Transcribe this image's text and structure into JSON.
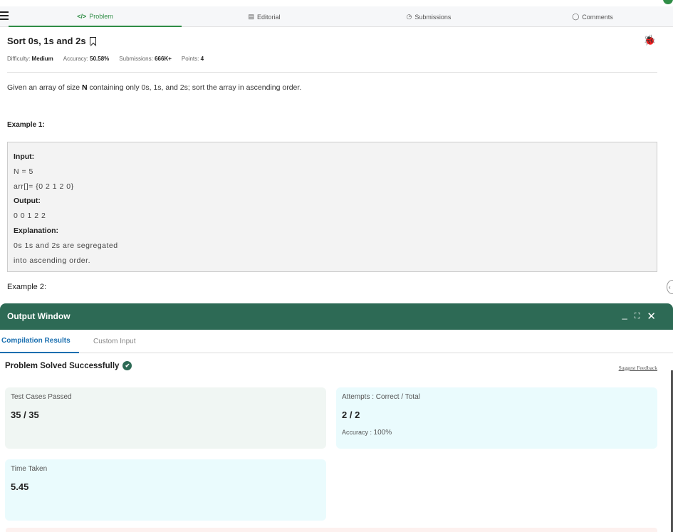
{
  "tabs": [
    {
      "label": "Problem",
      "icon": "code-icon",
      "glyph": "</>"
    },
    {
      "label": "Editorial",
      "icon": "document-icon",
      "glyph": "▤"
    },
    {
      "label": "Submissions",
      "icon": "clock-icon",
      "glyph": "◷"
    },
    {
      "label": "Comments",
      "icon": "comment-icon",
      "glyph": "◯"
    }
  ],
  "problem": {
    "title": "Sort 0s, 1s and 2s",
    "difficulty_label": "Difficulty:",
    "difficulty": "Medium",
    "accuracy_label": "Accuracy:",
    "accuracy": "50.58%",
    "submissions_label": "Submissions:",
    "submissions": "666K+",
    "points_label": "Points:",
    "points": "4",
    "desc_pre": "Given an array of size ",
    "desc_bold": "N",
    "desc_post": " containing only 0s, 1s, and 2s; sort the array in ascending order."
  },
  "example1": {
    "heading": "Example 1:",
    "input_label": "Input:",
    "input_line1": "N = 5",
    "input_line2": "arr[]= {0 2 1 2 0}",
    "output_label": "Output:",
    "output_line": "0 0 1 2 2",
    "explanation_label": "Explanation:",
    "explanation_line1": "0s 1s and 2s are segregated",
    "explanation_line2": "into ascending order."
  },
  "example2": {
    "heading": "Example 2:"
  },
  "output_window": {
    "title": "Output Window",
    "minimize": "_",
    "expand": "⛶",
    "close": "✕",
    "tabs": [
      "Compilation Results",
      "Custom Input"
    ],
    "status": "Problem Solved Successfully",
    "feedback": "Suggest Feedback",
    "cards": {
      "tests_caption": "Test Cases Passed",
      "tests_value": "35 / 35",
      "attempts_caption": "Attempts : Correct / Total",
      "attempts_value": "2 / 2",
      "accuracy_label": "Accuracy : ",
      "accuracy_value": "100%",
      "time_caption": "Time Taken",
      "time_value": "5.45"
    }
  },
  "colors": {
    "accent_green": "#2f8d46",
    "output_header": "#2d6a55",
    "link_blue": "#1a6fb0"
  }
}
